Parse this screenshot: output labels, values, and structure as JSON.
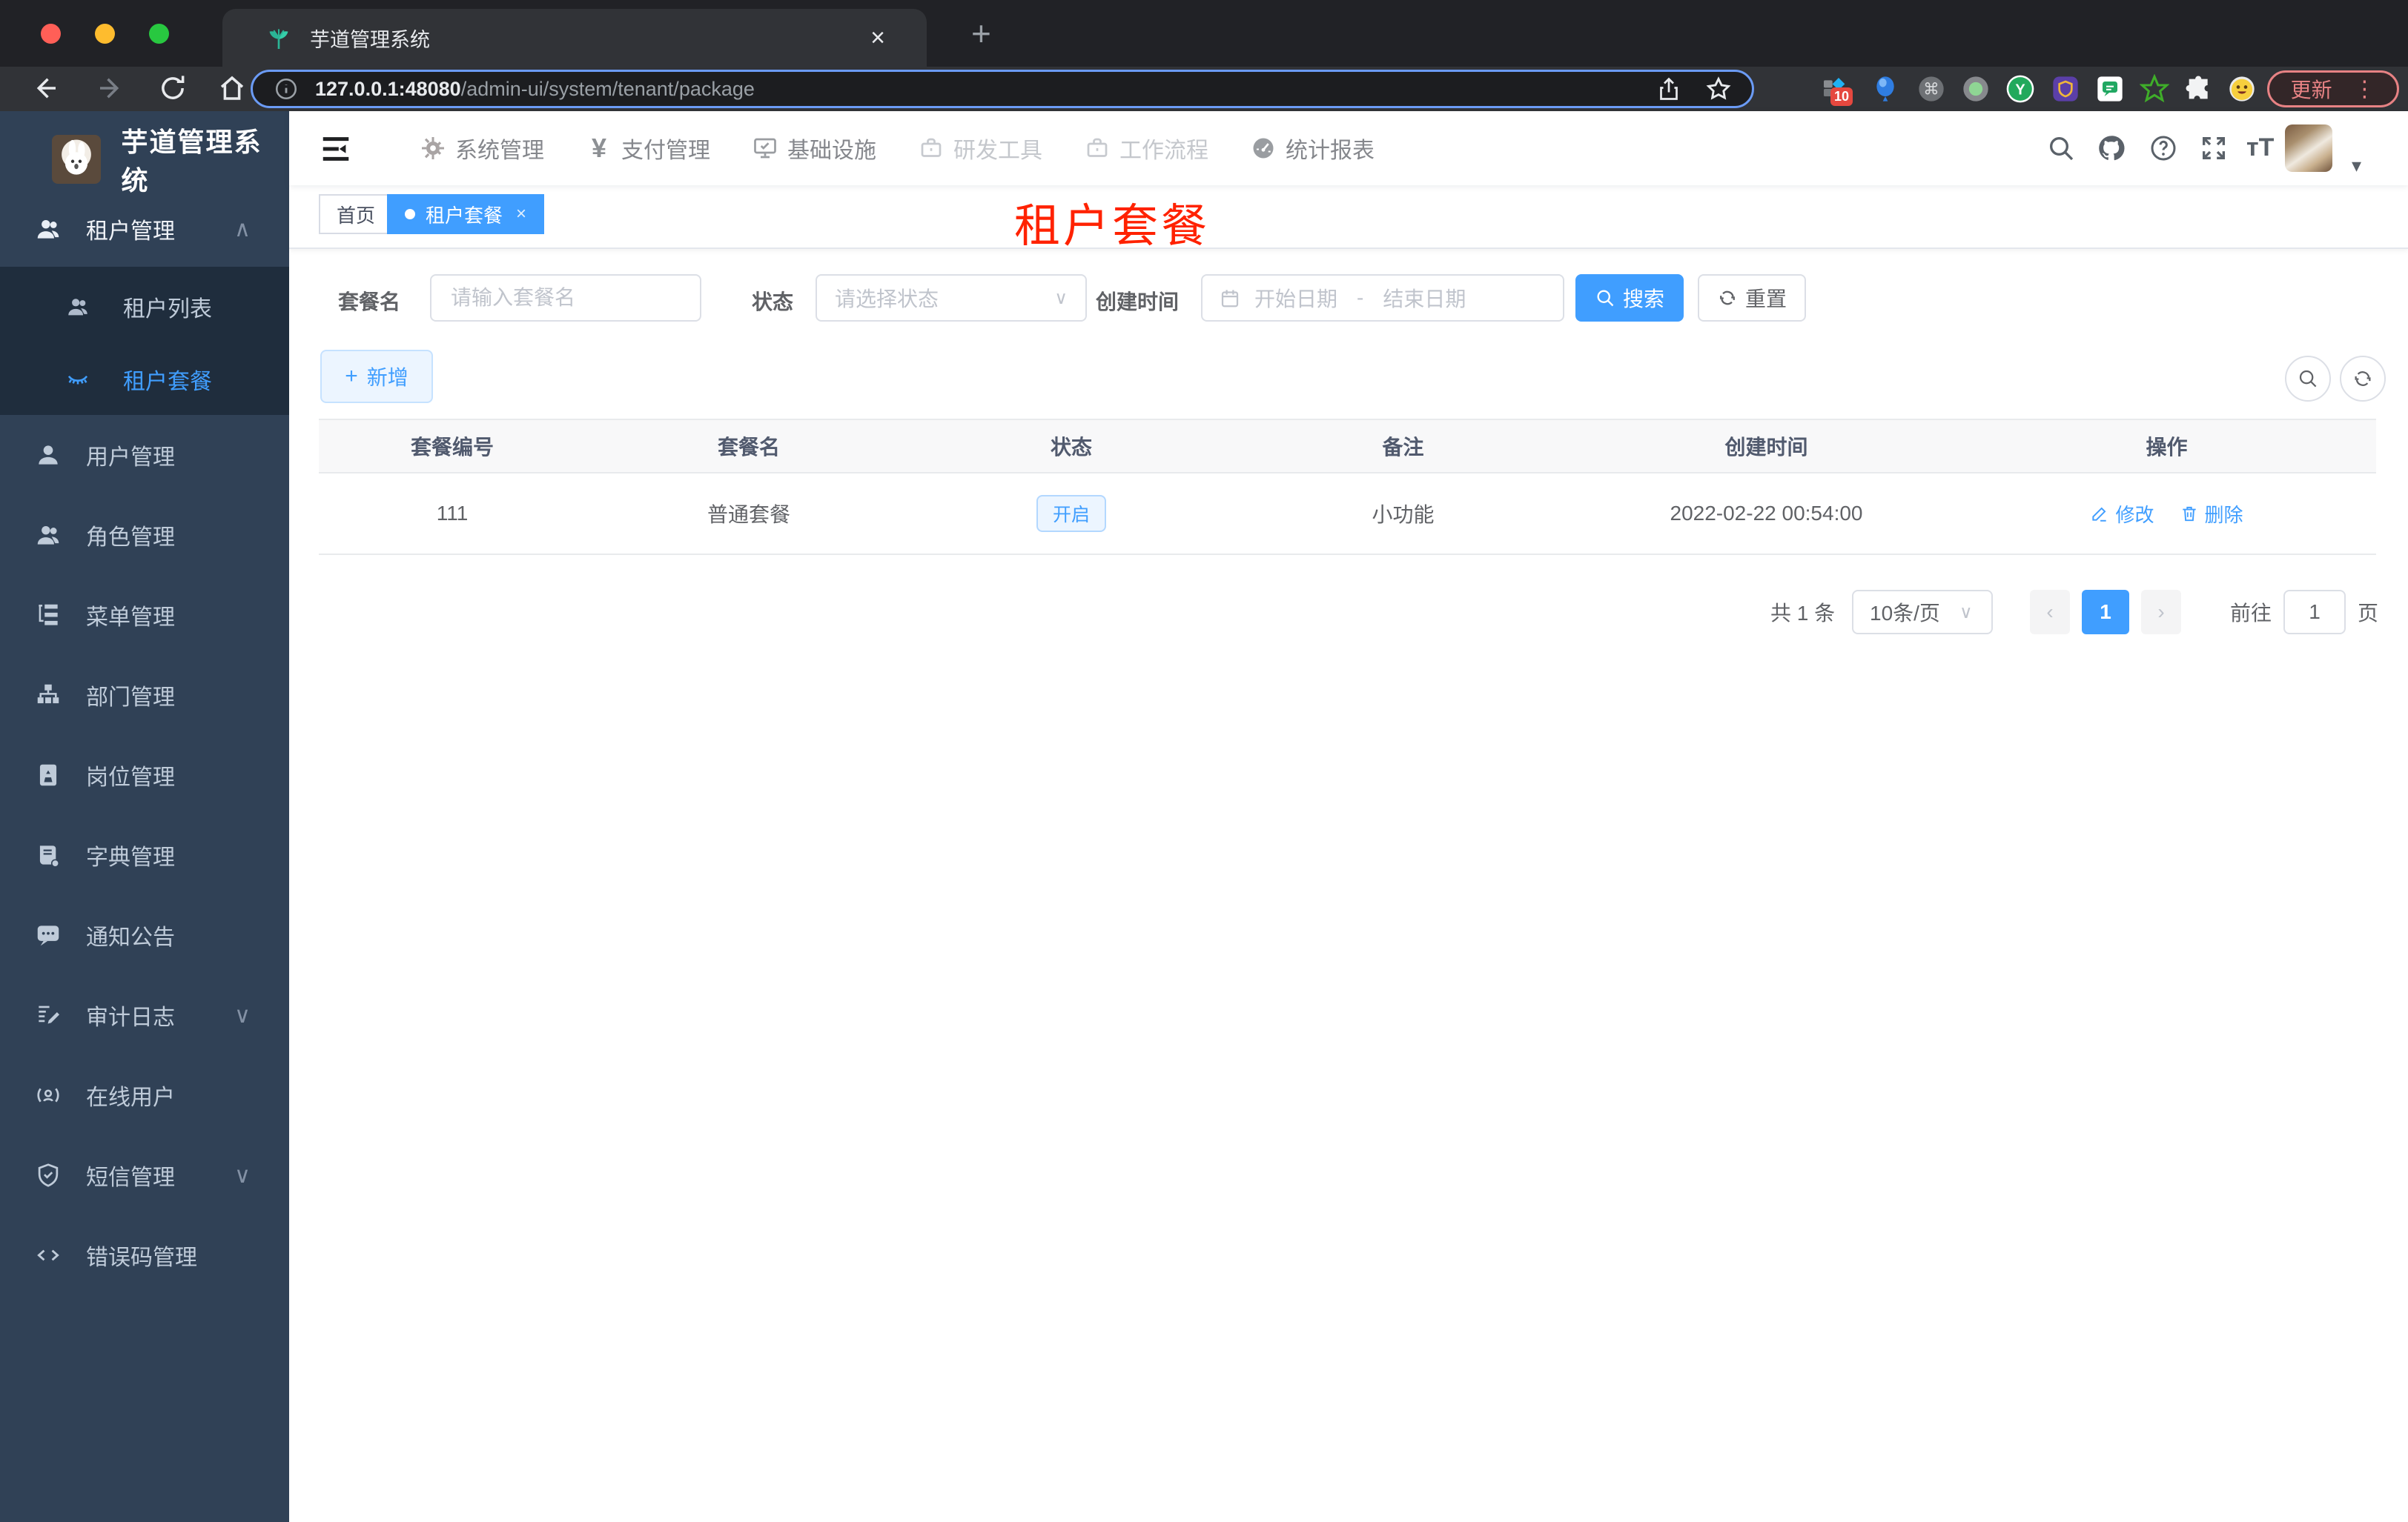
{
  "browser": {
    "tab_title": "芋道管理系统",
    "url_host": "127.0.0.1:48080",
    "url_path": "/admin-ui/system/tenant/package",
    "update_label": "更新",
    "ext_badge": "10"
  },
  "icons": {
    "close": "×",
    "plus": "+",
    "dots": "⋮",
    "caret_down": "▾",
    "chevron_up": "∧",
    "chevron_down": "∨",
    "page_prev": "‹",
    "page_next": "›",
    "font_size": "тT",
    "yen": "¥",
    "cmd": "⌘",
    "letter_y": "Y"
  },
  "app": {
    "brand": "芋道管理系统",
    "nav": {
      "items": [
        {
          "label": "系统管理"
        },
        {
          "label": "支付管理"
        },
        {
          "label": "基础设施"
        },
        {
          "label": "研发工具"
        },
        {
          "label": "工作流程"
        },
        {
          "label": "统计报表"
        }
      ]
    }
  },
  "sidebar": {
    "items": [
      {
        "label": "租户管理"
      },
      {
        "label": "租户列表"
      },
      {
        "label": "租户套餐"
      },
      {
        "label": "用户管理"
      },
      {
        "label": "角色管理"
      },
      {
        "label": "菜单管理"
      },
      {
        "label": "部门管理"
      },
      {
        "label": "岗位管理"
      },
      {
        "label": "字典管理"
      },
      {
        "label": "通知公告"
      },
      {
        "label": "审计日志"
      },
      {
        "label": "在线用户"
      },
      {
        "label": "短信管理"
      },
      {
        "label": "错误码管理"
      }
    ]
  },
  "tabs": {
    "home": "首页",
    "active": "租户套餐"
  },
  "watermark": "租户套餐",
  "filters": {
    "name_label": "套餐名",
    "name_placeholder": "请输入套餐名",
    "status_label": "状态",
    "status_placeholder": "请选择状态",
    "date_label": "创建时间",
    "date_start": "开始日期",
    "date_sep": "-",
    "date_end": "结束日期",
    "search_label": "搜索",
    "reset_label": "重置"
  },
  "toolbar": {
    "add_label": "新增"
  },
  "table": {
    "columns": [
      "套餐编号",
      "套餐名",
      "状态",
      "备注",
      "创建时间",
      "操作"
    ],
    "rows": [
      {
        "id": "111",
        "name": "普通套餐",
        "status": "开启",
        "remark": "小功能",
        "created": "2022-02-22 00:54:00",
        "edit_label": "修改",
        "delete_label": "删除"
      }
    ]
  },
  "pagination": {
    "total": "共 1 条",
    "size": "10条/页",
    "page": "1",
    "goto_label": "前往",
    "goto_value": "1",
    "unit_label": "页"
  },
  "colors": {
    "accent": "#409eff",
    "sidebar_bg": "#304156",
    "submenu_bg": "#1f2d3d",
    "watermark": "#ff2200"
  }
}
